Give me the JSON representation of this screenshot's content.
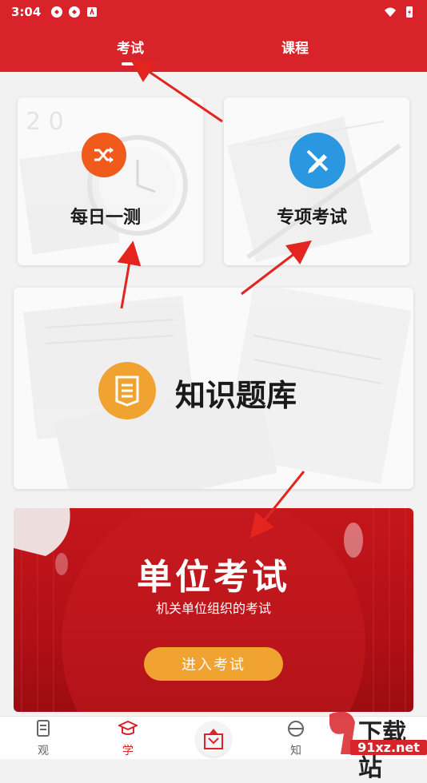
{
  "status_bar": {
    "time": "3:04"
  },
  "header": {
    "tabs": [
      {
        "label": "考试"
      },
      {
        "label": "课程"
      }
    ]
  },
  "cards": {
    "daily": {
      "title": "每日一测",
      "icon": "shuffle-icon",
      "color": "#f05a1a"
    },
    "special": {
      "title": "专项考试",
      "icon": "pencil-ruler-icon",
      "color": "#2b97e0"
    },
    "bank": {
      "title": "知识题库",
      "icon": "document-list-icon",
      "color": "#f0a330"
    }
  },
  "unit_exam": {
    "title": "单位考试",
    "subtitle": "机关单位组织的考试",
    "button": "进入考试"
  },
  "bottom_nav": {
    "items": [
      {
        "label": "观",
        "icon": "document-icon"
      },
      {
        "label": "学",
        "icon": "graduation-cap-icon"
      },
      {
        "label": "",
        "icon": "seal-logo-icon"
      },
      {
        "label": "知",
        "icon": "globe-icon"
      }
    ]
  },
  "watermark": {
    "brand": "下载站",
    "domain": "91xz.net"
  },
  "colors": {
    "primary": "#d8232a",
    "accent": "#f0a330"
  }
}
